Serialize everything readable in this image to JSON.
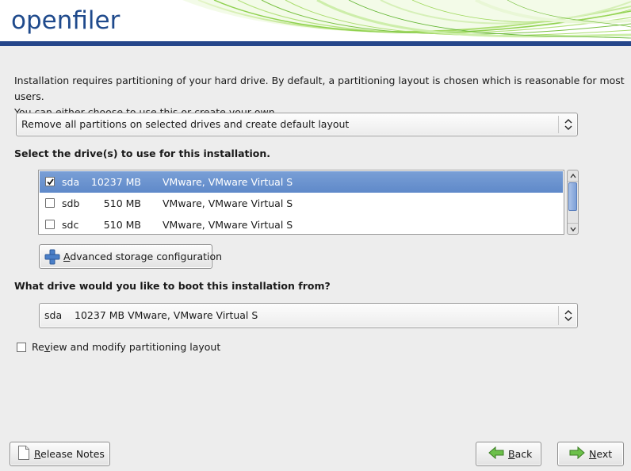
{
  "header": {
    "logo_text": "openfiler",
    "accent_color": "#25468a",
    "swoosh_color": "#8fd14f"
  },
  "intro": {
    "line1": "Installation requires partitioning of your hard drive.  By default, a partitioning layout is chosen which is reasonable for most users.",
    "line2": "You can either choose to use this or create your own."
  },
  "layout_select": {
    "value": "Remove all partitions on selected drives and create default layout"
  },
  "drives": {
    "label": "Select the drive(s) to use for this installation.",
    "rows": [
      {
        "checked": true,
        "name": "sda",
        "size": "10237 MB",
        "model": "VMware, VMware Virtual S",
        "selected": true
      },
      {
        "checked": false,
        "name": "sdb",
        "size": "510 MB",
        "model": "VMware, VMware Virtual S",
        "selected": false
      },
      {
        "checked": false,
        "name": "sdc",
        "size": "510 MB",
        "model": "VMware, VMware Virtual S",
        "selected": false
      }
    ]
  },
  "advanced_button": {
    "label_mnemonic": "A",
    "label_rest": "dvanced storage configuration",
    "icon": "plus-icon"
  },
  "boot": {
    "label": "What drive would you like to boot this installation from?",
    "value_name": "sda",
    "value_detail": "10237 MB VMware, VMware Virtual S"
  },
  "review": {
    "checked": false,
    "label_pre": "Re",
    "label_mnemonic": "v",
    "label_post": "iew and modify partitioning layout"
  },
  "footer": {
    "release_notes_mnemonic": "R",
    "release_notes_rest": "elease Notes",
    "back_mnemonic": "B",
    "back_rest": "ack",
    "next_mnemonic": "N",
    "next_rest": "ext"
  }
}
